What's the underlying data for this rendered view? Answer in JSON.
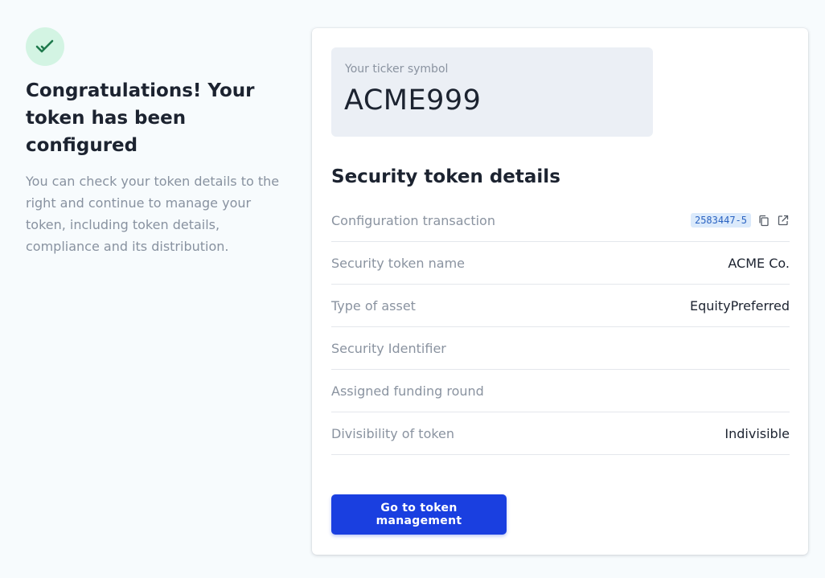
{
  "header": {
    "icon": "check-icon",
    "title": "Congratulations! Your token has been configured",
    "description": "You can check your token details to the right and continue to manage your token, including token details, compliance and its distribution."
  },
  "ticker": {
    "label": "Your ticker symbol",
    "value": "ACME999"
  },
  "details": {
    "title": "Security token details",
    "rows": [
      {
        "label": "Configuration transaction",
        "value": "2583447-5"
      },
      {
        "label": "Security token name",
        "value": "ACME Co."
      },
      {
        "label": "Type of asset",
        "value": "EquityPreferred"
      },
      {
        "label": "Security Identifier",
        "value": ""
      },
      {
        "label": "Assigned funding round",
        "value": ""
      },
      {
        "label": "Divisibility of token",
        "value": "Indivisible"
      }
    ]
  },
  "actions": {
    "primary_label": "Go to token management"
  },
  "colors": {
    "accent": "#1a3fe0",
    "success": "#1f7a4d",
    "success_bg": "#d3f4e3",
    "badge_bg": "#dbeafb",
    "badge_text": "#2a63c2"
  }
}
